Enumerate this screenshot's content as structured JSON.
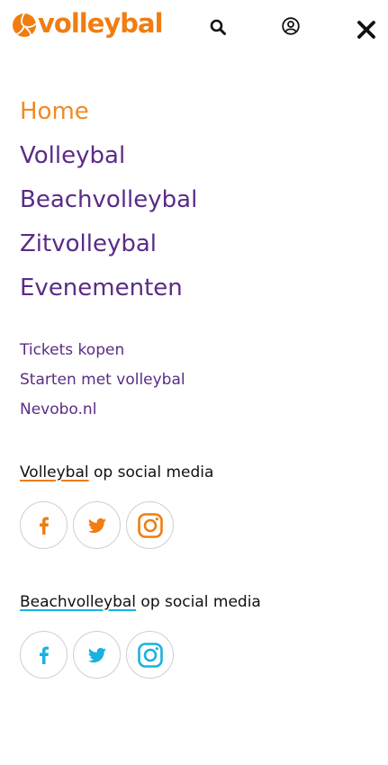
{
  "header": {
    "logo_text": "volleybal",
    "colors": {
      "brand_orange": "#f07d12",
      "purple": "#5b2c86",
      "beach_blue": "#19b2de"
    },
    "icons": [
      "volleyball-logo-icon",
      "search-icon",
      "user-icon",
      "close-icon"
    ]
  },
  "main_nav": [
    {
      "label": "Home",
      "active": true
    },
    {
      "label": "Volleybal",
      "active": false
    },
    {
      "label": "Beachvolleybal",
      "active": false
    },
    {
      "label": "Zitvolleybal",
      "active": false
    },
    {
      "label": "Evenementen",
      "active": false
    }
  ],
  "secondary_nav": [
    {
      "label": "Tickets kopen"
    },
    {
      "label": "Starten met volleybal"
    },
    {
      "label": "Nevobo.nl"
    }
  ],
  "social_volleybal": {
    "brand": "Volleybal",
    "suffix": " op social media",
    "icons": [
      "facebook-icon",
      "twitter-icon",
      "instagram-icon"
    ]
  },
  "social_beach": {
    "brand": "Beachvolleybal",
    "suffix": " op social media",
    "icons": [
      "facebook-icon",
      "twitter-icon",
      "instagram-icon"
    ]
  }
}
